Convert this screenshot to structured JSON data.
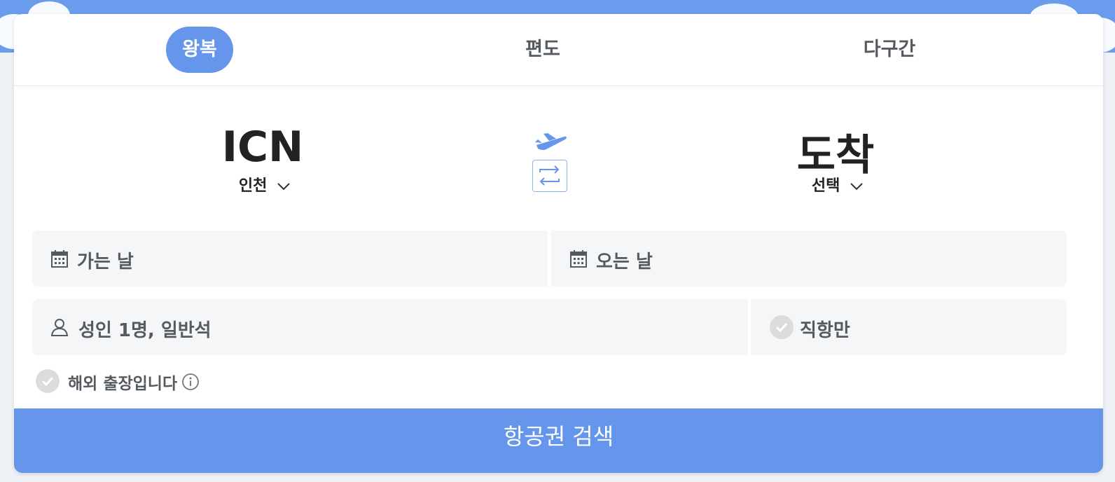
{
  "tabs": [
    {
      "label": "왕복",
      "active": true
    },
    {
      "label": "편도",
      "active": false
    },
    {
      "label": "다구간",
      "active": false
    }
  ],
  "route": {
    "origin": {
      "code": "ICN",
      "city": "인천"
    },
    "destination": {
      "code": "도착",
      "city": "선택"
    }
  },
  "dates": {
    "departure_label": "가는 날",
    "return_label": "오는 날"
  },
  "passengers": {
    "label": "성인 1명, 일반석"
  },
  "direct_only": {
    "label": "직항만",
    "checked": false
  },
  "business_trip": {
    "label": "해외 출장입니다",
    "checked": false
  },
  "search_button": {
    "label": "항공권 검색"
  },
  "colors": {
    "accent": "#6696ec",
    "field_bg": "#f5f6f8",
    "text_dark": "#222222",
    "text_muted": "#555a61",
    "check_bg": "#dcdcdc"
  },
  "icons": [
    "airplane-icon",
    "swap-icon",
    "calendar-icon",
    "person-icon",
    "check-icon",
    "info-icon",
    "chevron-down-icon"
  ]
}
